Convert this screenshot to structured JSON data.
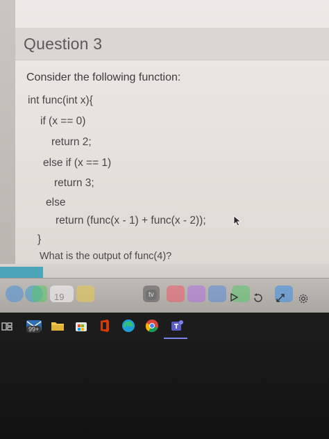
{
  "question": {
    "title": "Question 3",
    "intro": "Consider the following function:",
    "code_lines": [
      "int func(int x){",
      "if (x == 0)",
      "return 2;",
      "else if (x == 1)",
      "return 3;",
      "else",
      "return (func(x - 1) + func(x - 2));",
      "}"
    ],
    "prompt": "What is the output of func(4)?"
  },
  "dock": {
    "calendar_date": "19",
    "tv_label": "tv"
  },
  "taskbar": {
    "mail_badge": "99+"
  },
  "colors": {
    "page_bg": "#e6e3de",
    "header_bg": "#dad7d2",
    "text": "#474747",
    "teal_accent": "#4aa6b8",
    "taskbar_bg": "#1c1c1c"
  },
  "icons": {
    "cursor": "pointer-cursor-icon",
    "dock": [
      "finder-icon",
      "safari-icon",
      "messages-icon",
      "calendar-icon",
      "notes-icon",
      "tv-icon",
      "music-icon",
      "podcasts-icon",
      "keynote-icon",
      "numbers-icon",
      "app-store-icon",
      "settings-icon"
    ],
    "taskbar": [
      "task-view-icon",
      "mail-icon",
      "file-explorer-icon",
      "store-icon",
      "office-icon",
      "edge-icon",
      "chrome-icon",
      "teams-icon"
    ]
  }
}
